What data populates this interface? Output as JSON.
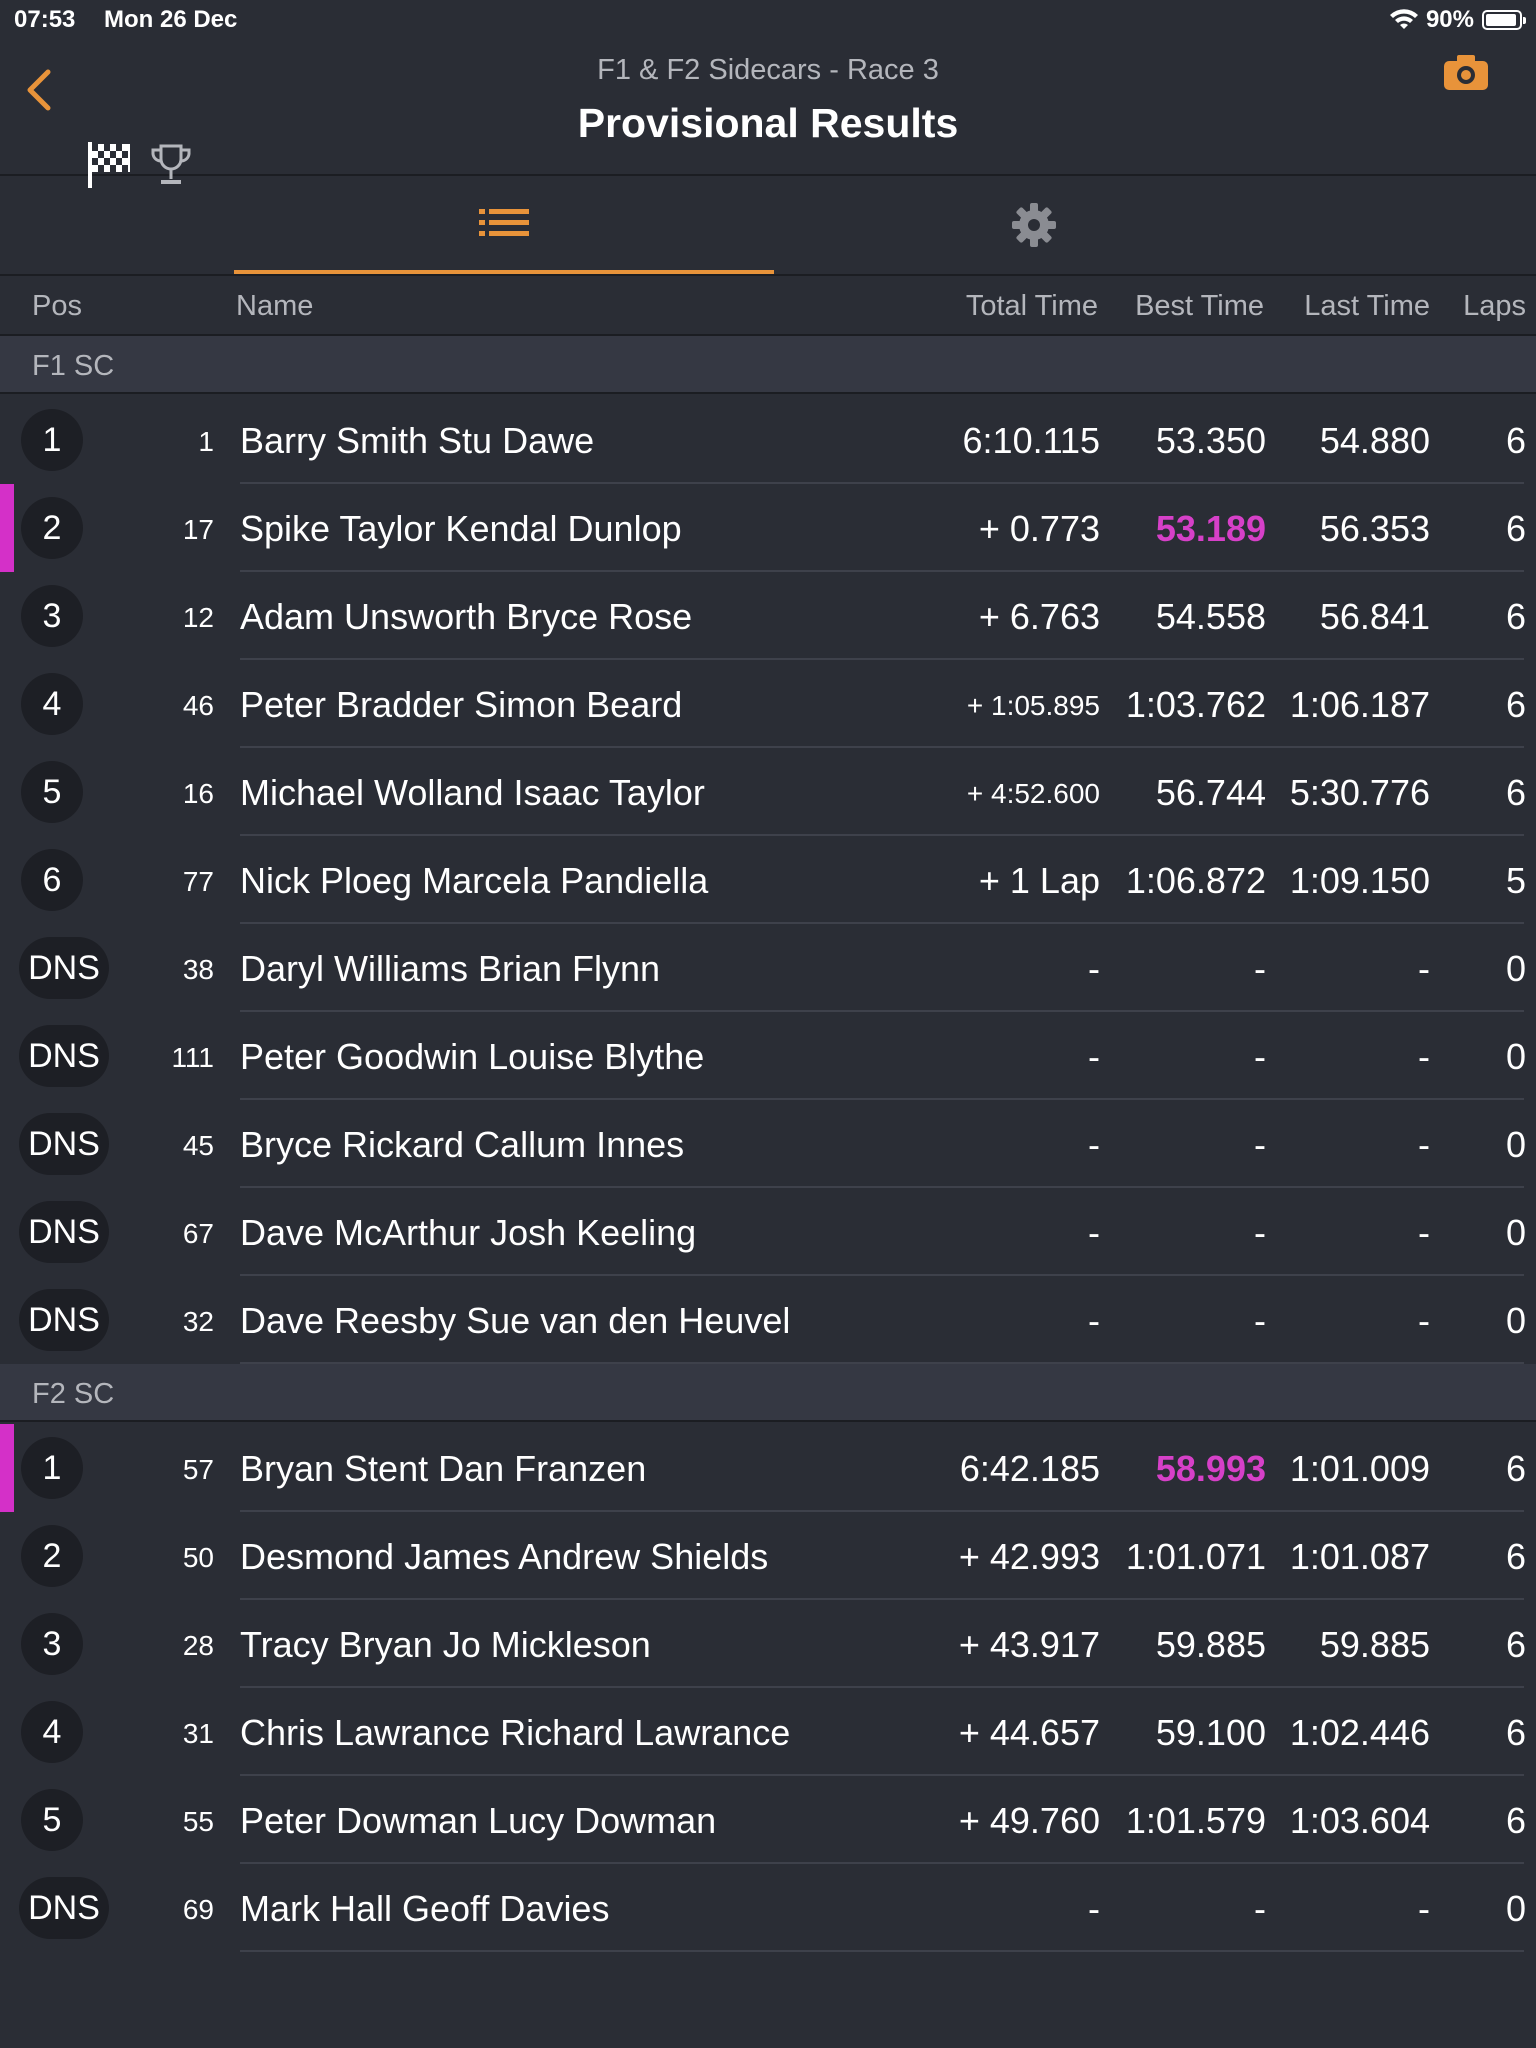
{
  "status": {
    "time": "07:53",
    "date": "Mon 26 Dec",
    "battery": "90%"
  },
  "header": {
    "subtitle": "F1 & F2 Sidecars - Race 3",
    "title": "Provisional Results"
  },
  "columns": {
    "pos": "Pos",
    "name": "Name",
    "total": "Total Time",
    "best": "Best Time",
    "last": "Last Time",
    "laps": "Laps"
  },
  "groups": [
    {
      "label": "F1 SC",
      "rows": [
        {
          "pos": "1",
          "no": "1",
          "name": "Barry Smith Stu Dawe",
          "total": "6:10.115",
          "best": "53.350",
          "last": "54.880",
          "laps": "6"
        },
        {
          "pos": "2",
          "no": "17",
          "name": "Spike Taylor Kendal Dunlop",
          "total": "+ 0.773",
          "best": "53.189",
          "last": "56.353",
          "laps": "6",
          "fastest": true
        },
        {
          "pos": "3",
          "no": "12",
          "name": "Adam Unsworth Bryce Rose",
          "total": "+ 6.763",
          "best": "54.558",
          "last": "56.841",
          "laps": "6"
        },
        {
          "pos": "4",
          "no": "46",
          "name": "Peter Bradder Simon Beard",
          "total": "+ 1:05.895",
          "best": "1:03.762",
          "last": "1:06.187",
          "laps": "6",
          "smallTotal": true
        },
        {
          "pos": "5",
          "no": "16",
          "name": "Michael Wolland Isaac Taylor",
          "total": "+ 4:52.600",
          "best": "56.744",
          "last": "5:30.776",
          "laps": "6",
          "smallTotal": true
        },
        {
          "pos": "6",
          "no": "77",
          "name": "Nick Ploeg Marcela Pandiella",
          "total": "+ 1 Lap",
          "best": "1:06.872",
          "last": "1:09.150",
          "laps": "5"
        },
        {
          "pos": "DNS",
          "no": "38",
          "name": "Daryl Williams Brian Flynn",
          "total": "-",
          "best": "-",
          "last": "-",
          "laps": "0"
        },
        {
          "pos": "DNS",
          "no": "111",
          "name": "Peter Goodwin Louise Blythe",
          "total": "-",
          "best": "-",
          "last": "-",
          "laps": "0"
        },
        {
          "pos": "DNS",
          "no": "45",
          "name": "Bryce Rickard Callum Innes",
          "total": "-",
          "best": "-",
          "last": "-",
          "laps": "0"
        },
        {
          "pos": "DNS",
          "no": "67",
          "name": "Dave McArthur Josh Keeling",
          "total": "-",
          "best": "-",
          "last": "-",
          "laps": "0"
        },
        {
          "pos": "DNS",
          "no": "32",
          "name": "Dave Reesby Sue van den Heuvel",
          "total": "-",
          "best": "-",
          "last": "-",
          "laps": "0"
        }
      ]
    },
    {
      "label": "F2 SC",
      "rows": [
        {
          "pos": "1",
          "no": "57",
          "name": "Bryan Stent Dan Franzen",
          "total": "6:42.185",
          "best": "58.993",
          "last": "1:01.009",
          "laps": "6",
          "fastest": true
        },
        {
          "pos": "2",
          "no": "50",
          "name": "Desmond James Andrew Shields",
          "total": "+ 42.993",
          "best": "1:01.071",
          "last": "1:01.087",
          "laps": "6"
        },
        {
          "pos": "3",
          "no": "28",
          "name": "Tracy Bryan Jo Mickleson",
          "total": "+ 43.917",
          "best": "59.885",
          "last": "59.885",
          "laps": "6"
        },
        {
          "pos": "4",
          "no": "31",
          "name": "Chris Lawrance Richard Lawrance",
          "total": "+ 44.657",
          "best": "59.100",
          "last": "1:02.446",
          "laps": "6"
        },
        {
          "pos": "5",
          "no": "55",
          "name": "Peter Dowman Lucy Dowman",
          "total": "+ 49.760",
          "best": "1:01.579",
          "last": "1:03.604",
          "laps": "6"
        },
        {
          "pos": "DNS",
          "no": "69",
          "name": "Mark Hall Geoff Davies",
          "total": "-",
          "best": "-",
          "last": "-",
          "laps": "0"
        }
      ]
    }
  ],
  "colors": {
    "accent": "#e8933a",
    "fastest": "#d640c8",
    "background": "#2a2d35"
  },
  "icons": [
    "back-chevron-icon",
    "checkered-flag-icon",
    "trophy-icon",
    "camera-icon",
    "list-icon",
    "gear-icon",
    "wifi-icon",
    "battery-icon"
  ]
}
